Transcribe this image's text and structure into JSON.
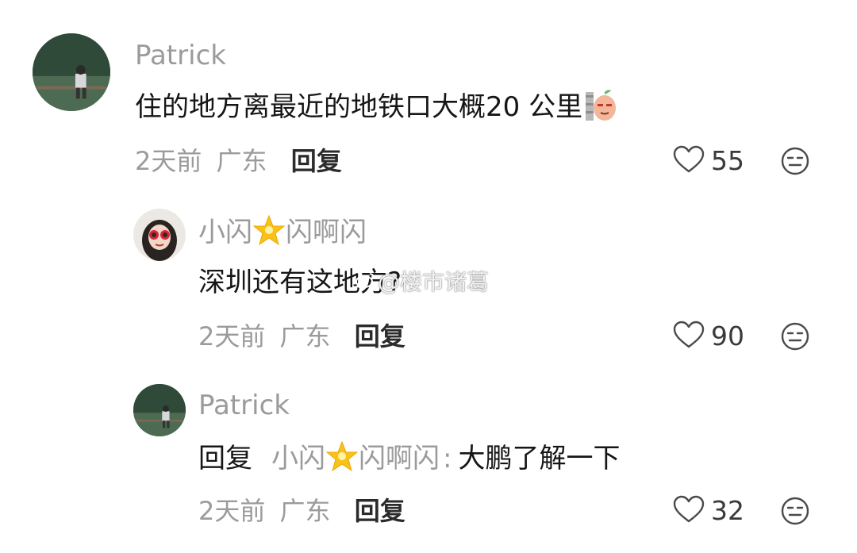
{
  "comments": [
    {
      "username": "Patrick",
      "text": "住的地方离最近的地铁口大概20 公里",
      "emoji_icon": "smug-egg-emoji",
      "time": "2天前",
      "location": "广东",
      "reply_label": "回复",
      "likes": "55"
    },
    {
      "username_part1": "小闪",
      "username_part2": "闪啊闪",
      "username_star_icon": "glowing-star-icon",
      "text": "深圳还有这地方?",
      "time": "2天前",
      "location": "广东",
      "reply_label": "回复",
      "likes": "90"
    },
    {
      "username": "Patrick",
      "reply_prefix": "回复",
      "reply_target_part1": "小闪",
      "reply_target_part2": "闪啊闪",
      "reply_separator": ":",
      "text": "大鹏了解一下",
      "time": "2天前",
      "location": "广东",
      "reply_label": "回复",
      "likes": "32"
    }
  ],
  "watermark": "@楼市诸葛",
  "colors": {
    "meta_gray": "#9b9b9b",
    "text": "#161616"
  }
}
